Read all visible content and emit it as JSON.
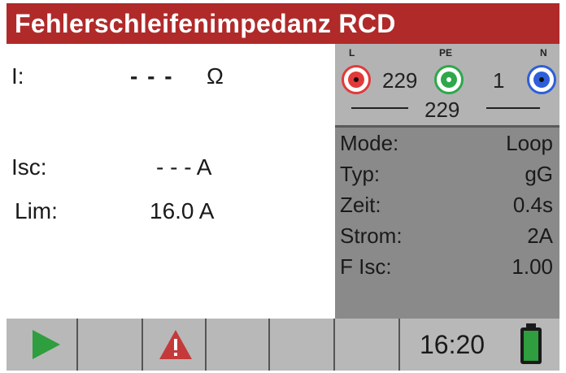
{
  "title": "Fehlerschleifenimpedanz RCD",
  "measurement": {
    "i_label": "I:",
    "i_value": "- - -",
    "i_unit": "Ω",
    "isc_label": "Isc:",
    "isc_value": "- - - A",
    "lim_label": "Lim:",
    "lim_value": "16.0 A"
  },
  "connections": {
    "l_label": "L",
    "pe_label": "PE",
    "n_label": "N",
    "v_l_pe": "229",
    "v_pe_n": "1",
    "v_l_n": "229",
    "colors": {
      "l": "#e23a3a",
      "pe": "#2ea84a",
      "n": "#2f5fd8"
    }
  },
  "parameters": [
    {
      "key": "Mode:",
      "value": "Loop"
    },
    {
      "key": "Typ:",
      "value": "gG"
    },
    {
      "key": "Zeit:",
      "value": "0.4s"
    },
    {
      "key": "Strom:",
      "value": "2A"
    },
    {
      "key": "F Isc:",
      "value": "1.00"
    }
  ],
  "statusbar": {
    "time": "16:20",
    "icons": [
      "play-icon",
      "warning-icon",
      "battery-icon"
    ],
    "colors": {
      "play": "#2e9e3e",
      "warning": "#c43a3a",
      "battery": "#2e9e3e"
    }
  }
}
